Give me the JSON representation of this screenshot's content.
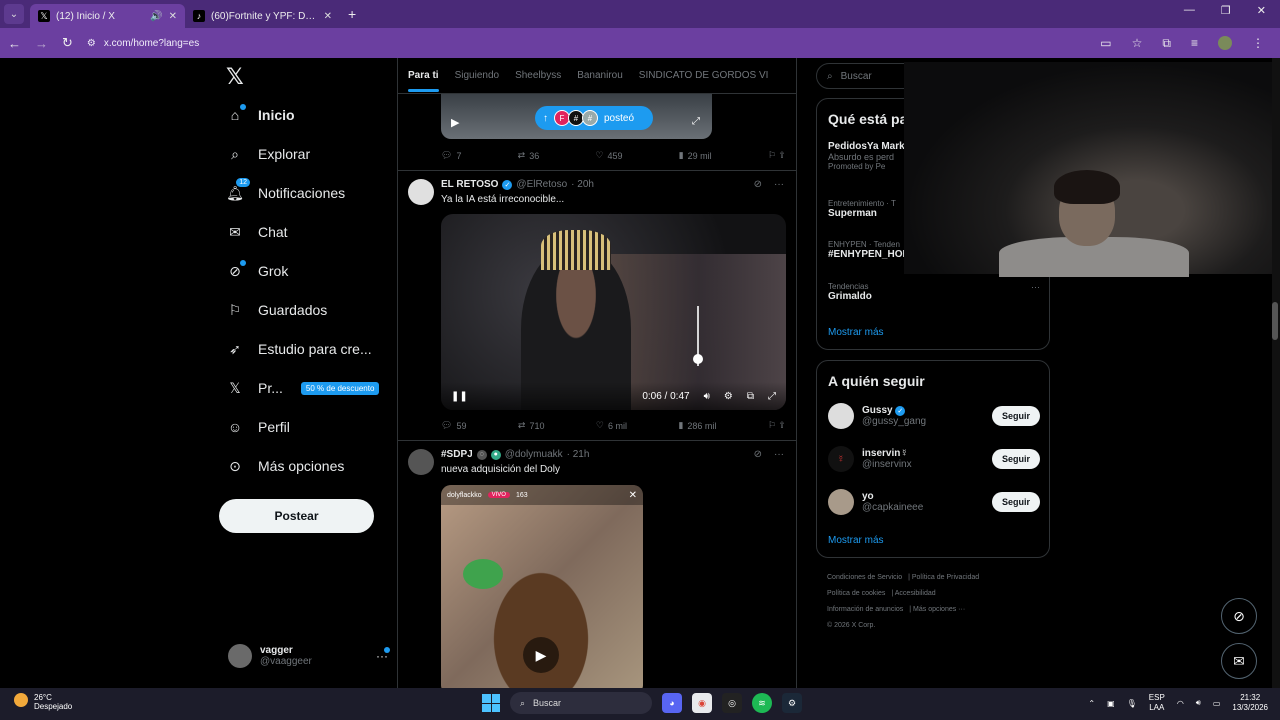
{
  "browser": {
    "tabs": [
      {
        "title": "(12) Inicio / X",
        "active": true,
        "favicon": "X"
      },
      {
        "title": "(60)Fortnite y YPF: Desafío de C",
        "active": false,
        "favicon": "♪"
      }
    ],
    "url": "x.com/home?lang=es",
    "accent": "#6b3fa0"
  },
  "nav": {
    "items": [
      {
        "label": "Inicio",
        "icon": "home-icon"
      },
      {
        "label": "Explorar",
        "icon": "search-icon"
      },
      {
        "label": "Notificaciones",
        "icon": "bell-icon",
        "badge": "12"
      },
      {
        "label": "Chat",
        "icon": "mail-icon"
      },
      {
        "label": "Grok",
        "icon": "grok-icon"
      },
      {
        "label": "Guardados",
        "icon": "bookmark-icon"
      },
      {
        "label": "Estudio para cre...",
        "icon": "rocket-icon"
      },
      {
        "label": "Pr...",
        "icon": "x-icon",
        "promo": "50 % de descuento"
      },
      {
        "label": "Perfil",
        "icon": "person-icon"
      },
      {
        "label": "Más opciones",
        "icon": "more-circle-icon"
      }
    ],
    "post_button": "Postear",
    "account": {
      "name": "vagger",
      "handle": "@vaaggeer"
    }
  },
  "timeline": {
    "tabs": [
      "Para ti",
      "Siguiendo",
      "Sheelbyss",
      "Bananirou",
      "SINDICATO DE GORDOS VI"
    ],
    "posted_pill": "posteó",
    "tweet0_actions": {
      "replies": "7",
      "reposts": "36",
      "likes": "459",
      "views": "29 mil"
    },
    "tweet1": {
      "name": "EL RETOSO",
      "handle": "@ElRetoso",
      "time": "· 20h",
      "text": "Ya la IA está irreconocible...",
      "video_time": "0:06 / 0:47",
      "volume_level": 0.2,
      "actions": {
        "replies": "59",
        "reposts": "710",
        "likes": "6 mil",
        "views": "286 mil"
      }
    },
    "tweet2": {
      "name": "#SDPJ",
      "handle": "@dolymuakk",
      "time": "· 21h",
      "text": "nueva adquisición del Doly",
      "stream_user": "dolyflackko",
      "live_label": "VIVO",
      "viewers": "163"
    }
  },
  "right": {
    "search_placeholder": "Buscar",
    "trends_title": "Qué está pa",
    "trends": [
      {
        "title": "PedidosYa Mark",
        "sub": "Absurdo es perd",
        "meta": "Promoted by Pe"
      },
      {
        "meta": "Entretenimiento · T",
        "title": "Superman"
      },
      {
        "meta": "ENHYPEN · Tenden",
        "title": "#ENHYPEN_HOM"
      },
      {
        "meta": "Tendencias",
        "title": "Grimaldo"
      }
    ],
    "show_more": "Mostrar más",
    "follow_title": "A quién seguir",
    "follow": [
      {
        "name": "Gussy",
        "handle": "@gussy_gang",
        "button": "Seguir"
      },
      {
        "name": "inservin☿",
        "handle": "@inservinx",
        "button": "Seguir"
      },
      {
        "name": "yo",
        "handle": "@capkaineee",
        "button": "Seguir"
      }
    ],
    "footer": [
      "Condiciones de Servicio",
      "Política de Privacidad",
      "Política de cookies",
      "Accesibilidad",
      "Información de anuncios",
      "Más opciones ···",
      "© 2026 X Corp."
    ]
  },
  "taskbar": {
    "temp": "26°C",
    "weather": "Despejado",
    "search": "Buscar",
    "lang1": "ESP",
    "lang2": "LAA",
    "time": "21:32",
    "date": "13/3/2026"
  }
}
